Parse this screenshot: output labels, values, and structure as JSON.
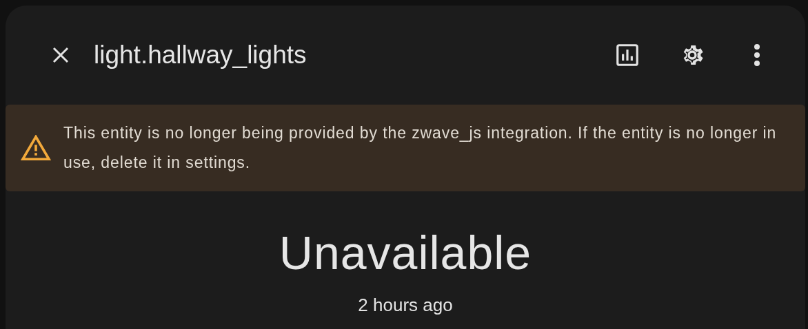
{
  "dialog": {
    "title": "light.hallway_lights"
  },
  "alert": {
    "kind": "warning",
    "message": "This entity is no longer being provided by the zwave_js integration. If the entity is no longer in use, delete it in settings."
  },
  "state": {
    "value": "Unavailable",
    "last_changed": "2 hours ago"
  }
}
